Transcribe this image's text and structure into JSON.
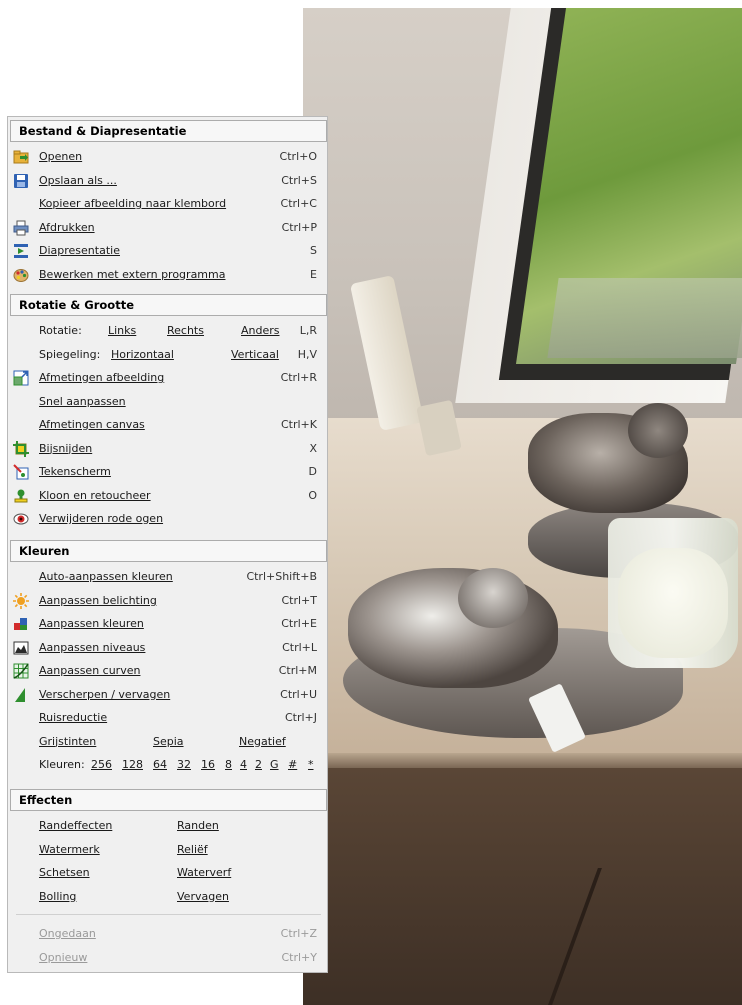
{
  "sections": {
    "bestand": {
      "title": "Bestand & Diapresentatie",
      "items": [
        {
          "label": "Openen",
          "shortcut": "Ctrl+O",
          "icon": "open-folder-icon"
        },
        {
          "label": "Opslaan als ...",
          "shortcut": "Ctrl+S",
          "icon": "save-disk-icon"
        },
        {
          "label": "Kopieer afbeelding naar klembord",
          "shortcut": "Ctrl+C",
          "icon": ""
        },
        {
          "label": "Afdrukken",
          "shortcut": "Ctrl+P",
          "icon": "printer-icon"
        },
        {
          "label": "Diapresentatie",
          "shortcut": "S",
          "icon": "slideshow-icon"
        },
        {
          "label": "Bewerken met extern programma",
          "shortcut": "E",
          "icon": "palette-icon"
        }
      ]
    },
    "rotatie": {
      "title": "Rotatie & Grootte",
      "rotatie": {
        "label": "Rotatie:",
        "links": "Links",
        "rechts": "Rechts",
        "anders": "Anders",
        "shortcut": "L,R"
      },
      "spiegeling": {
        "label": "Spiegeling:",
        "horizontaal": "Horizontaal",
        "verticaal": "Verticaal",
        "shortcut": "H,V"
      },
      "items": [
        {
          "label": "Afmetingen afbeelding",
          "shortcut": "Ctrl+R",
          "icon": "resize-icon"
        },
        {
          "label": "Snel aanpassen",
          "shortcut": "",
          "icon": ""
        },
        {
          "label": "Afmetingen canvas",
          "shortcut": "Ctrl+K",
          "icon": ""
        },
        {
          "label": "Bijsnijden",
          "shortcut": "X",
          "icon": "crop-icon"
        },
        {
          "label": "Tekenscherm",
          "shortcut": "D",
          "icon": "paint-icon"
        },
        {
          "label": "Kloon en retoucheer",
          "shortcut": "O",
          "icon": "clone-stamp-icon"
        },
        {
          "label": "Verwijderen rode ogen",
          "shortcut": "",
          "icon": "red-eye-icon"
        }
      ]
    },
    "kleuren": {
      "title": "Kleuren",
      "items": [
        {
          "label": "Auto-aanpassen kleuren",
          "shortcut": "Ctrl+Shift+B",
          "icon": ""
        },
        {
          "label": "Aanpassen belichting",
          "shortcut": "Ctrl+T",
          "icon": "sun-icon"
        },
        {
          "label": "Aanpassen kleuren",
          "shortcut": "Ctrl+E",
          "icon": "color-blocks-icon"
        },
        {
          "label": "Aanpassen niveaus",
          "shortcut": "Ctrl+L",
          "icon": "levels-icon"
        },
        {
          "label": "Aanpassen curven",
          "shortcut": "Ctrl+M",
          "icon": "curves-grid-icon"
        },
        {
          "label": "Verscherpen / vervagen",
          "shortcut": "Ctrl+U",
          "icon": "sharpen-icon"
        },
        {
          "label": "Ruisreductie",
          "shortcut": "Ctrl+J",
          "icon": ""
        }
      ],
      "modes": {
        "grijstinten": "Grijstinten",
        "sepia": "Sepia",
        "negatief": "Negatief"
      },
      "colors_label": "Kleuren:",
      "colors": [
        "256",
        "128",
        "64",
        "32",
        "16",
        "8",
        "4",
        "2",
        "G",
        "#",
        "*"
      ]
    },
    "effecten": {
      "title": "Effecten",
      "grid": [
        [
          "Randeffecten",
          "Randen"
        ],
        [
          "Watermerk",
          "Reliëf"
        ],
        [
          "Schetsen",
          "Waterverf"
        ],
        [
          "Bolling",
          "Vervagen"
        ]
      ]
    },
    "history": [
      {
        "label": "Ongedaan",
        "shortcut": "Ctrl+Z"
      },
      {
        "label": "Opnieuw",
        "shortcut": "Ctrl+Y"
      }
    ]
  },
  "icon_colors": {
    "folder": "#e8b23a",
    "disk": "#2f62b3",
    "green": "#2f8f2f",
    "red": "#d22b2b"
  }
}
